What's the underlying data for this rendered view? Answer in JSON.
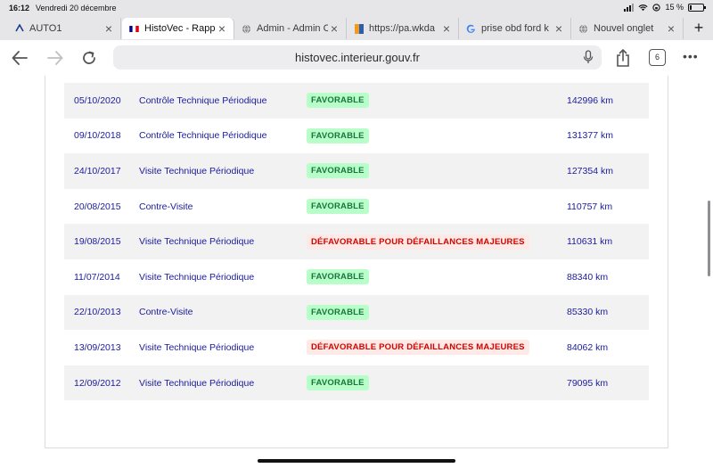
{
  "status_bar": {
    "time": "16:12",
    "date": "Vendredi 20 décembre",
    "battery": "15 %",
    "battery_level": 0.15
  },
  "tabs": [
    {
      "title": "AUTO1",
      "icon": "auto1-favicon",
      "active": false
    },
    {
      "title": "HistoVec - Rapport",
      "icon": "french-flag-favicon",
      "active": true
    },
    {
      "title": "Admin - Admin C",
      "icon": "globe-favicon",
      "active": false
    },
    {
      "title": "https://pa.wkda",
      "icon": "orange-blue-favicon",
      "active": false
    },
    {
      "title": "prise obd ford k",
      "icon": "google-favicon",
      "active": false
    },
    {
      "title": "Nouvel onglet",
      "icon": "globe-favicon",
      "active": false
    }
  ],
  "toolbar": {
    "url": "histovec.interieur.gouv.fr",
    "tab_count": "6"
  },
  "colors": {
    "favorable_bg": "#b8fec9",
    "favorable_text": "#18753c",
    "defavorable_bg": "#ffe9e6",
    "defavorable_text": "#ce0500",
    "row_text": "#1b1b9f"
  },
  "inspections": [
    {
      "date": "05/10/2020",
      "type": "Contrôle Technique Périodique",
      "result": "FAVORABLE",
      "status": "ok",
      "km": "142996 km"
    },
    {
      "date": "09/10/2018",
      "type": "Contrôle Technique Périodique",
      "result": "FAVORABLE",
      "status": "ok",
      "km": "131377 km"
    },
    {
      "date": "24/10/2017",
      "type": "Visite Technique Périodique",
      "result": "FAVORABLE",
      "status": "ok",
      "km": "127354 km"
    },
    {
      "date": "20/08/2015",
      "type": "Contre-Visite",
      "result": "FAVORABLE",
      "status": "ok",
      "km": "110757 km"
    },
    {
      "date": "19/08/2015",
      "type": "Visite Technique Périodique",
      "result": "DÉFAVORABLE POUR DÉFAILLANCES MAJEURES",
      "status": "ko",
      "km": "110631 km"
    },
    {
      "date": "11/07/2014",
      "type": "Visite Technique Périodique",
      "result": "FAVORABLE",
      "status": "ok",
      "km": "88340 km"
    },
    {
      "date": "22/10/2013",
      "type": "Contre-Visite",
      "result": "FAVORABLE",
      "status": "ok",
      "km": "85330 km"
    },
    {
      "date": "13/09/2013",
      "type": "Visite Technique Périodique",
      "result": "DÉFAVORABLE POUR DÉFAILLANCES MAJEURES",
      "status": "ko",
      "km": "84062 km"
    },
    {
      "date": "12/09/2012",
      "type": "Visite Technique Périodique",
      "result": "FAVORABLE",
      "status": "ok",
      "km": "79095 km"
    }
  ]
}
